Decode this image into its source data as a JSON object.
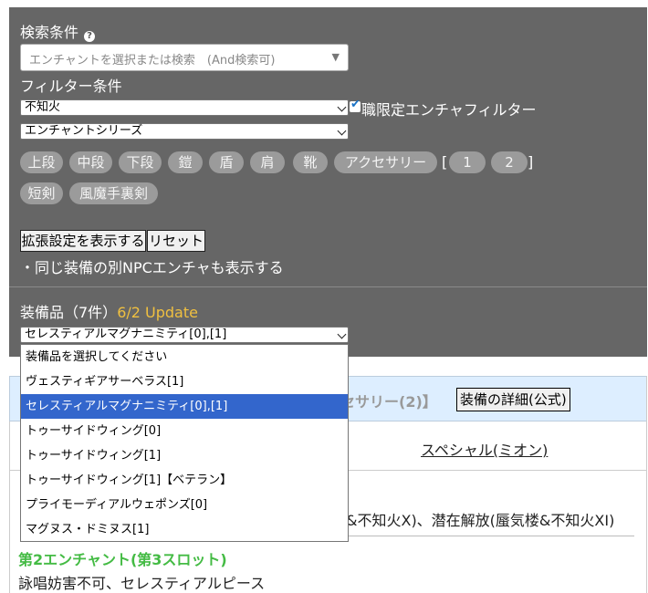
{
  "search": {
    "title": "検索条件",
    "help_icon": "?",
    "placeholder": "エンチャントを選択または検索　(And検索可)",
    "combo_arrow": "▼"
  },
  "filter": {
    "title": "フィルター条件",
    "selected_class": "不知火",
    "job_filter_label": "職限定エンチャフィルター",
    "selected_series": "エンチャントシリーズ"
  },
  "chips": {
    "row1": [
      "上段",
      "中段",
      "下段",
      "鎧",
      "盾",
      "肩",
      "靴",
      "アクセサリー"
    ],
    "bracket_open": "[",
    "bracket_close": "]",
    "pages": [
      "1",
      "2"
    ],
    "row2": [
      "短剣",
      "風魔手裏剣"
    ]
  },
  "buttons": {
    "extended": "拡張設定を表示する",
    "reset": "リセット"
  },
  "npc_text": "・同じ装備の別NPCエンチャも表示する",
  "equipment": {
    "title": "装備品（7件）",
    "update": "6/2 Update",
    "selected": "セレスティアルマグナニミティ[0],[1]",
    "options": [
      "装備品を選択してください",
      "ヴェスティギアサーベラス[1]",
      "セレスティアルマグナニミティ[0],[1]",
      "トゥーサイドウィング[0]",
      "トゥーサイドウィング[1]",
      "トゥーサイドウィング[1]【ベテラン】",
      "プライモーディアルウェポンズ[0]",
      "マグヌス・ドミヌス[1]"
    ],
    "highlighted_index": 2
  },
  "result": {
    "band_text": "セサリー(2)】",
    "detail_button": "装備の詳細(公式)",
    "npc_link": "スペシャル(ミオン)",
    "partial_line": "&不知火X)、潜在解放(蜃気楼&不知火XI)",
    "slot2_title": "第2エンチャント(第3スロット)",
    "slot2_value": "詠唱妨害不可、セレスティアルピース"
  },
  "colors": {
    "panel_bg": "#666666",
    "update_accent": "#f0c040",
    "highlight": "#3366cc",
    "band_bg": "#ddeeff",
    "green_title": "#44bb44"
  }
}
